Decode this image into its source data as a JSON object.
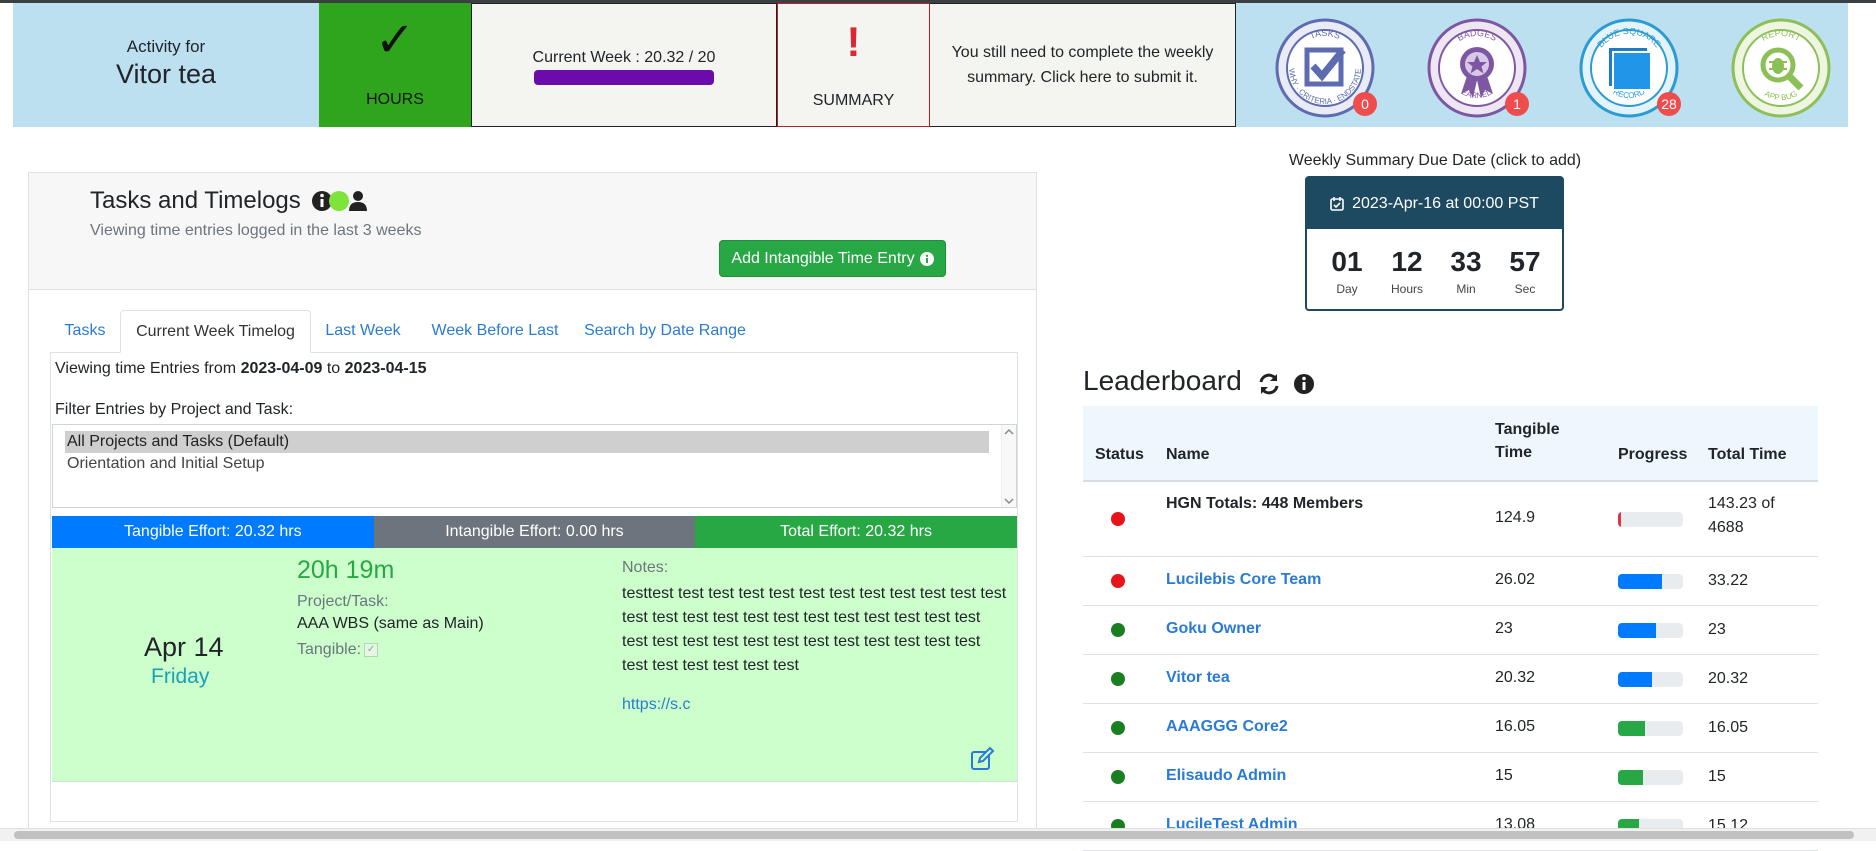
{
  "header": {
    "activity_label": "Activity for",
    "user_name": "Vitor tea",
    "hours_label": "HOURS",
    "current_week_text": "Current Week : 20.32 / 20",
    "current_week_progress": 1.0,
    "summary_label": "SUMMARY",
    "summary_reminder": "You still need to complete the weekly summary. Click here to submit it.",
    "badges": [
      {
        "top": "TASKS",
        "bottom": "WHY · CRITERIA · ENDSTATE",
        "count": "0",
        "icon": "checkbox-icon"
      },
      {
        "top": "BADGES",
        "bottom": "EARNED",
        "count": "1",
        "icon": "star-ribbon-icon"
      },
      {
        "top": "BLUE SQUARE",
        "bottom": "RECORD",
        "count": "28",
        "icon": "blue-square-icon"
      },
      {
        "top": "REPORT",
        "bottom": "APP BUG",
        "count": "",
        "icon": "bug-icon"
      }
    ]
  },
  "tasks_panel": {
    "title": "Tasks and Timelogs",
    "subtitle": "Viewing time entries logged in the last 3 weeks",
    "add_button": "Add Intangible Time Entry",
    "tabs": [
      "Tasks",
      "Current Week Timelog",
      "Last Week",
      "Week Before Last",
      "Search by Date Range"
    ],
    "active_tab": "Current Week Timelog",
    "viewing_prefix": "Viewing time Entries from",
    "viewing_from": "2023-04-09",
    "viewing_to_word": "to",
    "viewing_to": "2023-04-15",
    "filter_label": "Filter Entries by Project and Task:",
    "filter_options": [
      "All Projects and Tasks (Default)",
      "Orientation and Initial Setup"
    ],
    "effort": {
      "tangible": "Tangible Effort: 20.32 hrs",
      "intangible": "Intangible Effort: 0.00 hrs",
      "total": "Total Effort: 20.32 hrs"
    },
    "entry": {
      "date": "Apr 14",
      "day": "Friday",
      "duration": "20h 19m",
      "project_task_label": "Project/Task:",
      "project_task": "AAA WBS (same as Main)",
      "tangible_label": "Tangible:",
      "notes_label": "Notes:",
      "notes": "testtest test test test test test test test test test test test test test test test test test test test test test test test test test test test test test test test test test test test test test test test test test",
      "link": "https://s.c"
    }
  },
  "due_date": {
    "label": "Weekly Summary Due Date (click to add)",
    "date_text": "2023-Apr-16 at 00:00 PST",
    "countdown": [
      {
        "value": "01",
        "unit": "Day"
      },
      {
        "value": "12",
        "unit": "Hours"
      },
      {
        "value": "33",
        "unit": "Min"
      },
      {
        "value": "57",
        "unit": "Sec"
      }
    ]
  },
  "leaderboard": {
    "title": "Leaderboard",
    "columns": {
      "status": "Status",
      "name": "Name",
      "tangible_1": "Tangible",
      "tangible_2": "Time",
      "progress": "Progress",
      "total": "Total Time"
    },
    "rows": [
      {
        "status_color": "#e8141c",
        "name": "HGN Totals: 448 Members",
        "tangible": "124.9",
        "progress": 0.04,
        "bar_color": "#dc3545",
        "total_line1": "143.23 of",
        "total_line2": "4688",
        "plain": true
      },
      {
        "status_color": "#e8141c",
        "name": "Lucilebis Core Team",
        "tangible": "26.02",
        "progress": 0.67,
        "bar_color": "#007bff",
        "total_line1": "33.22",
        "total_line2": ""
      },
      {
        "status_color": "#1a7f21",
        "name": "Goku Owner",
        "tangible": "23",
        "progress": 0.58,
        "bar_color": "#007bff",
        "total_line1": "23",
        "total_line2": ""
      },
      {
        "status_color": "#1a7f21",
        "name": "Vitor tea",
        "tangible": "20.32",
        "progress": 0.52,
        "bar_color": "#007bff",
        "total_line1": "20.32",
        "total_line2": ""
      },
      {
        "status_color": "#1a7f21",
        "name": "AAAGGG Core2",
        "tangible": "16.05",
        "progress": 0.41,
        "bar_color": "#28a745",
        "total_line1": "16.05",
        "total_line2": ""
      },
      {
        "status_color": "#1a7f21",
        "name": "Elisaudo Admin",
        "tangible": "15",
        "progress": 0.38,
        "bar_color": "#28a745",
        "total_line1": "15",
        "total_line2": ""
      },
      {
        "status_color": "#1a7f21",
        "name": "LucileTest Admin",
        "tangible": "13.08",
        "progress": 0.33,
        "bar_color": "#28a745",
        "total_line1": "15.12",
        "total_line2": ""
      }
    ]
  }
}
